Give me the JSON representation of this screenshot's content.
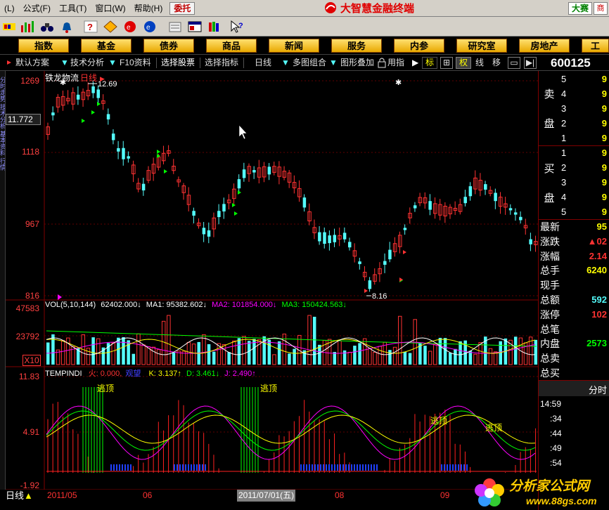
{
  "menu": {
    "items": [
      "(L)",
      "公式(F)",
      "工具(T)",
      "窗口(W)",
      "帮助(H)"
    ],
    "order_button": "委托",
    "app_title": "大智慧金融终端",
    "contest_button": "大赛",
    "right_button": "商"
  },
  "categories": [
    "指数",
    "基金",
    "债券",
    "商品",
    "新闻",
    "服务",
    "内参",
    "研究室",
    "房地产",
    "工"
  ],
  "funcbar": {
    "items": [
      "默认方案",
      "技术分析",
      "F10资料",
      "选择股票",
      "选择指标",
      "日线",
      "多图组合",
      "图形叠加",
      "用指",
      "标",
      "权",
      "线",
      "移"
    ],
    "stock_code": "600125"
  },
  "sidebar_text": "分时走势 技术分析 基本资料 行情",
  "price_chart": {
    "stock_name": "铁龙物流",
    "period": "日线",
    "axis_labels": [
      "1269",
      "11.772",
      "1118",
      "967",
      "816"
    ],
    "high_label": "12.69",
    "low_label": "8.16"
  },
  "volume_chart": {
    "header": "VOL(5,10,144)",
    "vol": "62402.000↓",
    "ma1": "MA1: 95382.602↓",
    "ma2": "MA2: 101854.000↓",
    "ma3": "MA3: 150424.563↓",
    "axis_labels": [
      "47583",
      "23792",
      "X10"
    ]
  },
  "indicator_chart": {
    "name": "TEMPINDI",
    "fire": "火: 0.000",
    "observe": "观望",
    "k": "K: 3.137↑",
    "d": "D: 3.461↓",
    "j": "J: 2.490↑",
    "axis_labels": [
      "11.83",
      "4.91",
      "-1.92"
    ],
    "signal_text": "逃顶"
  },
  "time_axis": {
    "period_button": "日线",
    "labels": [
      "2011/05",
      "06",
      "2011/07/01(五)",
      "08",
      "09"
    ]
  },
  "right_panel": {
    "sell_label": [
      "卖",
      "盘"
    ],
    "buy_label": [
      "买",
      "盘"
    ],
    "sell_levels": [
      "5",
      "4",
      "3",
      "2",
      "1"
    ],
    "sell_prices": [
      "9",
      "9",
      "9",
      "9",
      "9"
    ],
    "buy_levels": [
      "1",
      "2",
      "3",
      "4",
      "5"
    ],
    "buy_prices": [
      "9",
      "9",
      "9",
      "9",
      "9"
    ],
    "quote_labels": [
      "最新",
      "涨跌",
      "涨幅",
      "总手",
      "现手",
      "总额",
      "涨停",
      "总笔",
      "内盘",
      "总卖",
      "总买"
    ],
    "quote_values": [
      "95",
      "▲02",
      "2.14",
      "6240",
      "",
      "592",
      "102",
      "",
      "2573",
      "",
      ""
    ],
    "minute_header": "分时",
    "minute_times": [
      "14:59",
      ":34",
      ":44",
      ":49",
      ":54"
    ],
    "minute_values": [
      "",
      "",
      "",
      "",
      ""
    ]
  },
  "colors": {
    "up": "#ff3232",
    "down": "#54fcfc",
    "ma_white": "#ffffff",
    "ma_yellow": "#ffff00",
    "ma_magenta": "#ff00ff",
    "ma_green": "#00ff00",
    "category_bg": "#f0b800"
  },
  "watermark": {
    "title": "分析家公式网",
    "url": "www.88gs.com"
  }
}
